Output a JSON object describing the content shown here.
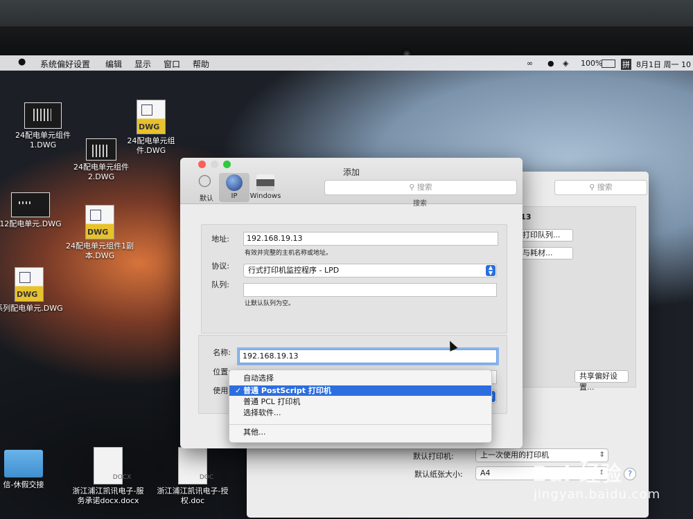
{
  "menubar": {
    "apple": "",
    "items": [
      "系统偏好设置",
      "编辑",
      "显示",
      "窗口",
      "帮助"
    ],
    "battery": "100%",
    "input_method": "拼",
    "clock": "8月1日 周一 10"
  },
  "desktop": {
    "icons": [
      {
        "label": "24配电单元组件\n1.DWG"
      },
      {
        "label": "24配电单元组\n件.DWG"
      },
      {
        "label": "24配电单元组件\n2.DWG"
      },
      {
        "label": "12配电单元.DWG"
      },
      {
        "label": "24配电单元组件1副\n本.DWG"
      },
      {
        "label": "系列配电单元.DWG"
      },
      {
        "label": "信-休假交接"
      },
      {
        "label": "浙江浦江凯讯电子-服\n务承诺docx.docx"
      },
      {
        "label": "浙江浦江凯讯电子-授\n权.doc"
      }
    ],
    "dwg_tag": "DWG",
    "docx_tag": "DOCX",
    "doc_tag": "DOC"
  },
  "bg_window": {
    "search_placeholder": "搜索",
    "ip_partial": ".13",
    "btn_queue": "打印队列...",
    "btn_supplies": "与耗材...",
    "btn_share": "共享偏好设置...",
    "default_printer_label": "默认打印机:",
    "default_printer_value": "上一次使用的打印机",
    "paper_size_label": "默认纸张大小:",
    "paper_size_value": "A4",
    "help": "?"
  },
  "dialog": {
    "title": "添加",
    "toolbar": [
      {
        "label": "默认"
      },
      {
        "label": "IP"
      },
      {
        "label": "Windows"
      }
    ],
    "search_placeholder": "搜索",
    "search_caption": "搜索",
    "address_label": "地址:",
    "address_value": "192.168.19.13",
    "address_hint": "有效并完整的主机名称或地址。",
    "protocol_label": "协议:",
    "protocol_value": "行式打印机监控程序 - LPD",
    "queue_label": "队列:",
    "queue_value": "",
    "queue_hint": "让默认队列为空。",
    "name_label": "名称:",
    "name_value": "192.168.19.13",
    "location_label": "位置:",
    "use_label": "使用:"
  },
  "menu": {
    "items": [
      "自动选择",
      "普通 PostScript 打印机",
      "普通 PCL 打印机",
      "选择软件...",
      "其他..."
    ],
    "selected_index": 1,
    "checkmark": "✓"
  },
  "watermark": {
    "logo": "Bai 经验",
    "url": "jingyan.baidu.com"
  },
  "colors": {
    "accent": "#2c6ee0",
    "close": "#fc5f57",
    "minimize": "#d8d8d8",
    "zoom": "#2fc840"
  }
}
